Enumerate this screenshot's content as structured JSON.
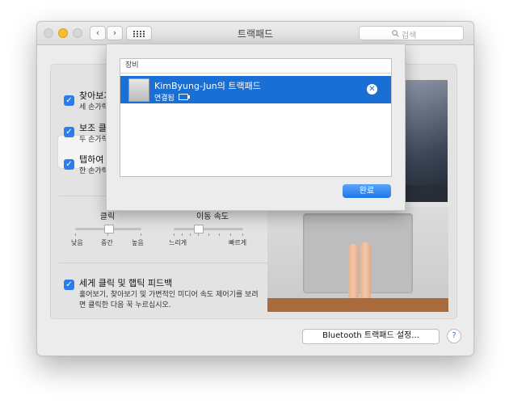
{
  "window": {
    "title": "트랙패드"
  },
  "search": {
    "placeholder": "검색"
  },
  "options": [
    {
      "title": "찾아보기",
      "subtitle": "세 손가락"
    },
    {
      "title": "보조 클릭",
      "subtitle": "두 손가락"
    },
    {
      "title": "탭하여 클릭",
      "subtitle": "한 손가락"
    }
  ],
  "sliders": {
    "click": {
      "label": "클릭",
      "ticks": [
        "낮음",
        "중간",
        "높음"
      ],
      "value": 0.5
    },
    "speed": {
      "label": "이동 속도",
      "ticks": [
        "느리게",
        "빠르게"
      ],
      "value": 0.35
    }
  },
  "force_click": {
    "title": "세게 클릭 및 햅틱 피드백",
    "description_line1": "훑어보기, 찾아보기 및 가변적인 미디어 속도 제어기를 보려",
    "description_line2": "면 클릭한 다음 꾹 누르십시오."
  },
  "bluetooth_button": "Bluetooth 트랙패드 설정...",
  "help_button": "?",
  "sheet": {
    "header": "장비",
    "device": {
      "name": "KimByung-Jun의 트랙패드",
      "status": "연결됨"
    },
    "done_button": "완료"
  },
  "colors": {
    "accent": "#1a6fd5",
    "checkbox": "#2b7de9"
  },
  "icons": [
    "back-arrow-icon",
    "forward-arrow-icon",
    "grid-icon",
    "search-icon",
    "remove-icon",
    "battery-icon"
  ]
}
